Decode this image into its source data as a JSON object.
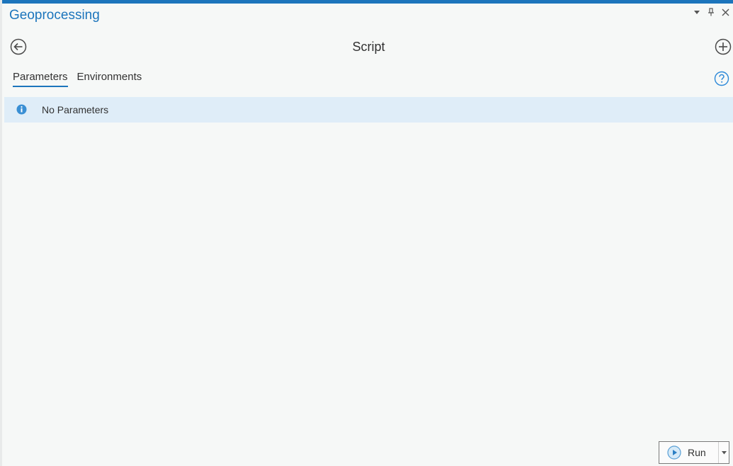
{
  "pane": {
    "title": "Geoprocessing",
    "accent_color": "#1c75bc"
  },
  "window_controls": {
    "items": [
      "dropdown-icon",
      "pin-icon",
      "close-icon"
    ]
  },
  "header": {
    "tool_title": "Script",
    "back_icon": "arrow-left-circle-icon",
    "add_icon": "plus-circle-icon"
  },
  "tabs": [
    {
      "label": "Parameters",
      "active": true
    },
    {
      "label": "Environments",
      "active": false
    }
  ],
  "help_icon": "question-circle-icon",
  "message": {
    "icon": "info-icon",
    "text": "No Parameters",
    "background": "#dfedf8"
  },
  "run": {
    "label": "Run",
    "icon": "play-circle-icon",
    "dropdown_icon": "caret-down-icon"
  }
}
